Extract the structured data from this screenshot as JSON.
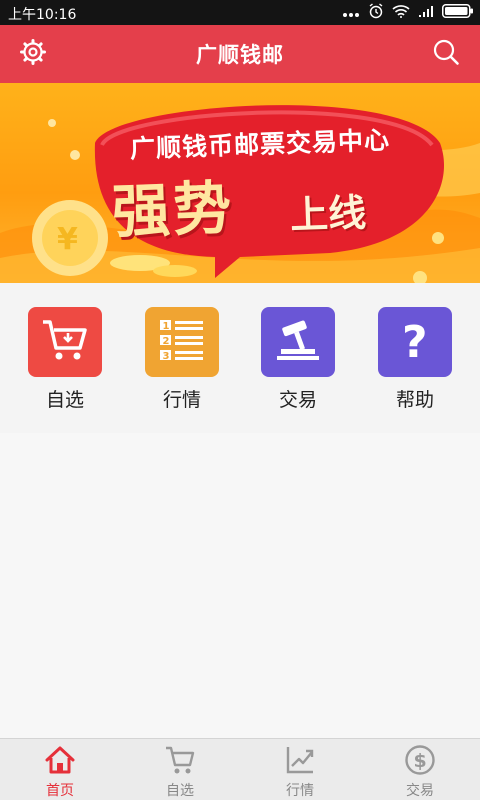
{
  "status_bar": {
    "time": "上午10:16"
  },
  "header": {
    "title": "广顺钱邮"
  },
  "banner": {
    "line1": "广顺钱币邮票交易中心",
    "line2": "强势",
    "line2b": "上线"
  },
  "menu": [
    {
      "label": "自选",
      "color": "#ee4a43",
      "icon": "cart-icon"
    },
    {
      "label": "行情",
      "color": "#f0a432",
      "icon": "list-icon"
    },
    {
      "label": "交易",
      "color": "#6a56d6",
      "icon": "gavel-icon"
    },
    {
      "label": "帮助",
      "color": "#6a56d6",
      "icon": "help-icon"
    }
  ],
  "tabs": [
    {
      "label": "首页",
      "icon": "home-icon",
      "active": true
    },
    {
      "label": "自选",
      "icon": "cart-icon",
      "active": false
    },
    {
      "label": "行情",
      "icon": "chart-icon",
      "active": false
    },
    {
      "label": "交易",
      "icon": "dollar-icon",
      "active": false
    }
  ],
  "colors": {
    "accent": "#e43f4b",
    "active_tab": "#e5303a",
    "inactive_tab": "#888888"
  }
}
